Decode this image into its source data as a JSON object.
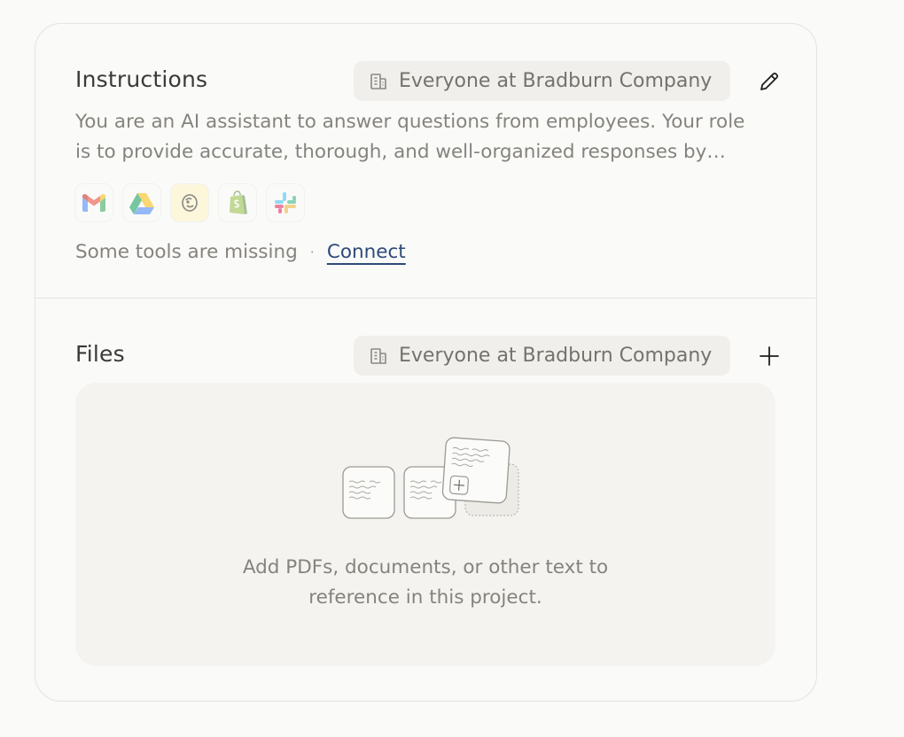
{
  "instructions": {
    "title": "Instructions",
    "scope": "Everyone at Bradburn Company",
    "scope_icon": "building-icon",
    "action_icon": "pencil-icon",
    "description_line1": "You are an AI assistant to answer questions from employees. Your role",
    "description_line2": "is to provide accurate, thorough, and well-organized responses by…",
    "tools": [
      {
        "name": "gmail-icon"
      },
      {
        "name": "google-drive-icon"
      },
      {
        "name": "mailchimp-icon"
      },
      {
        "name": "shopify-icon"
      },
      {
        "name": "slack-icon"
      }
    ],
    "missing_text": "Some tools are missing",
    "separator": "·",
    "connect_label": "Connect"
  },
  "files": {
    "title": "Files",
    "scope": "Everyone at Bradburn Company",
    "scope_icon": "building-icon",
    "action_icon": "plus-icon",
    "empty_line1": "Add PDFs, documents, or other text to",
    "empty_line2": "reference in this project."
  },
  "colors": {
    "background": "#fafaf9",
    "link": "#2d4a78",
    "text_primary": "#3b3a36",
    "text_secondary": "#85837c",
    "pill_bg": "#f0efeb"
  }
}
